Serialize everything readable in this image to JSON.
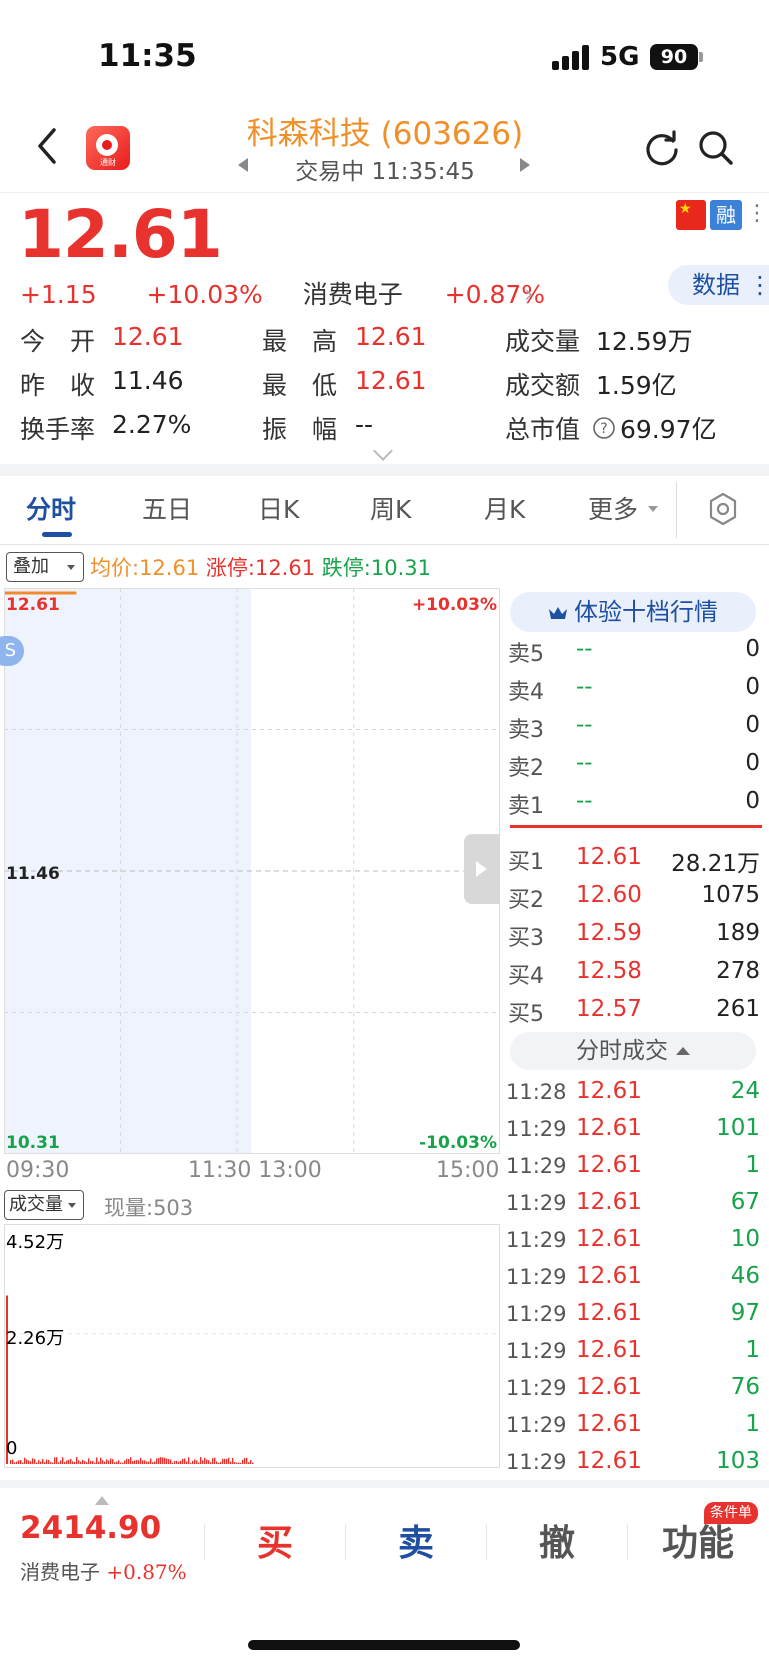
{
  "status_bar": {
    "time": "11:35",
    "network": "5G",
    "battery": "90"
  },
  "header": {
    "title": "科森科技 (603626)",
    "trade_status": "交易中 11:35:45",
    "logo_text": "通财"
  },
  "quote": {
    "price": "12.61",
    "change": "+1.15",
    "change_pct": "+10.03%",
    "sector": "消费电子",
    "sector_pct": "+0.87%",
    "margin_badge": "融",
    "data_button": "数据",
    "stats": {
      "open_label": "今　开",
      "open": "12.61",
      "high_label": "最　高",
      "high": "12.61",
      "volume_label": "成交量",
      "volume": "12.59万",
      "prev_close_label": "昨　收",
      "prev_close": "11.46",
      "low_label": "最　低",
      "low": "12.61",
      "turnover_label": "成交额",
      "turnover": "1.59亿",
      "turnover_rate_label": "换手率",
      "turnover_rate": "2.27%",
      "amplitude_label": "振　幅",
      "amplitude": "--",
      "mktcap_label": "总市值",
      "mktcap": "69.97亿"
    }
  },
  "tabs": [
    "分时",
    "五日",
    "日K",
    "周K",
    "月K",
    "更多"
  ],
  "overlay": {
    "button": "叠加",
    "avg": "均价:12.61",
    "limit_up": "涨停:12.61",
    "limit_down": "跌停:10.31"
  },
  "chart_data": {
    "type": "line",
    "y_top": "12.61",
    "y_mid": "11.46",
    "y_bottom": "10.31",
    "pct_top": "+10.03%",
    "pct_bottom": "-10.03%",
    "x_labels": [
      "09:30",
      "11:30 13:00",
      "15:00"
    ],
    "ylim": [
      10.31,
      12.61
    ],
    "series": [
      {
        "x_start": "09:30",
        "x_end": "11:35",
        "value": 12.61
      }
    ],
    "s_badge": "S"
  },
  "volume": {
    "button": "成交量",
    "current": "现量:503",
    "labels": [
      "4.52万",
      "2.26万",
      "0"
    ],
    "ylim": [
      0,
      45200
    ]
  },
  "order_book": {
    "ten_level_button": "体验十档行情",
    "asks": [
      {
        "label": "卖5",
        "price": "--",
        "vol": "0"
      },
      {
        "label": "卖4",
        "price": "--",
        "vol": "0"
      },
      {
        "label": "卖3",
        "price": "--",
        "vol": "0"
      },
      {
        "label": "卖2",
        "price": "--",
        "vol": "0"
      },
      {
        "label": "卖1",
        "price": "--",
        "vol": "0"
      }
    ],
    "bids": [
      {
        "label": "买1",
        "price": "12.61",
        "vol": "28.21万"
      },
      {
        "label": "买2",
        "price": "12.60",
        "vol": "1075"
      },
      {
        "label": "买3",
        "price": "12.59",
        "vol": "189"
      },
      {
        "label": "买4",
        "price": "12.58",
        "vol": "278"
      },
      {
        "label": "买5",
        "price": "12.57",
        "vol": "261"
      }
    ]
  },
  "ticks": {
    "header": "分时成交",
    "rows": [
      {
        "time": "11:28",
        "price": "12.61",
        "vol": "24"
      },
      {
        "time": "11:29",
        "price": "12.61",
        "vol": "101"
      },
      {
        "time": "11:29",
        "price": "12.61",
        "vol": "1"
      },
      {
        "time": "11:29",
        "price": "12.61",
        "vol": "67"
      },
      {
        "time": "11:29",
        "price": "12.61",
        "vol": "10"
      },
      {
        "time": "11:29",
        "price": "12.61",
        "vol": "46"
      },
      {
        "time": "11:29",
        "price": "12.61",
        "vol": "97"
      },
      {
        "time": "11:29",
        "price": "12.61",
        "vol": "1"
      },
      {
        "time": "11:29",
        "price": "12.61",
        "vol": "76"
      },
      {
        "time": "11:29",
        "price": "12.61",
        "vol": "1"
      },
      {
        "time": "11:29",
        "price": "12.61",
        "vol": "103"
      }
    ]
  },
  "bottom_bar": {
    "index_value": "2414.90",
    "index_name": "消费电子",
    "index_pct": "+0.87%",
    "buy": "买",
    "sell": "卖",
    "cancel": "撤",
    "function": "功能",
    "cond_badge": "条件单"
  }
}
